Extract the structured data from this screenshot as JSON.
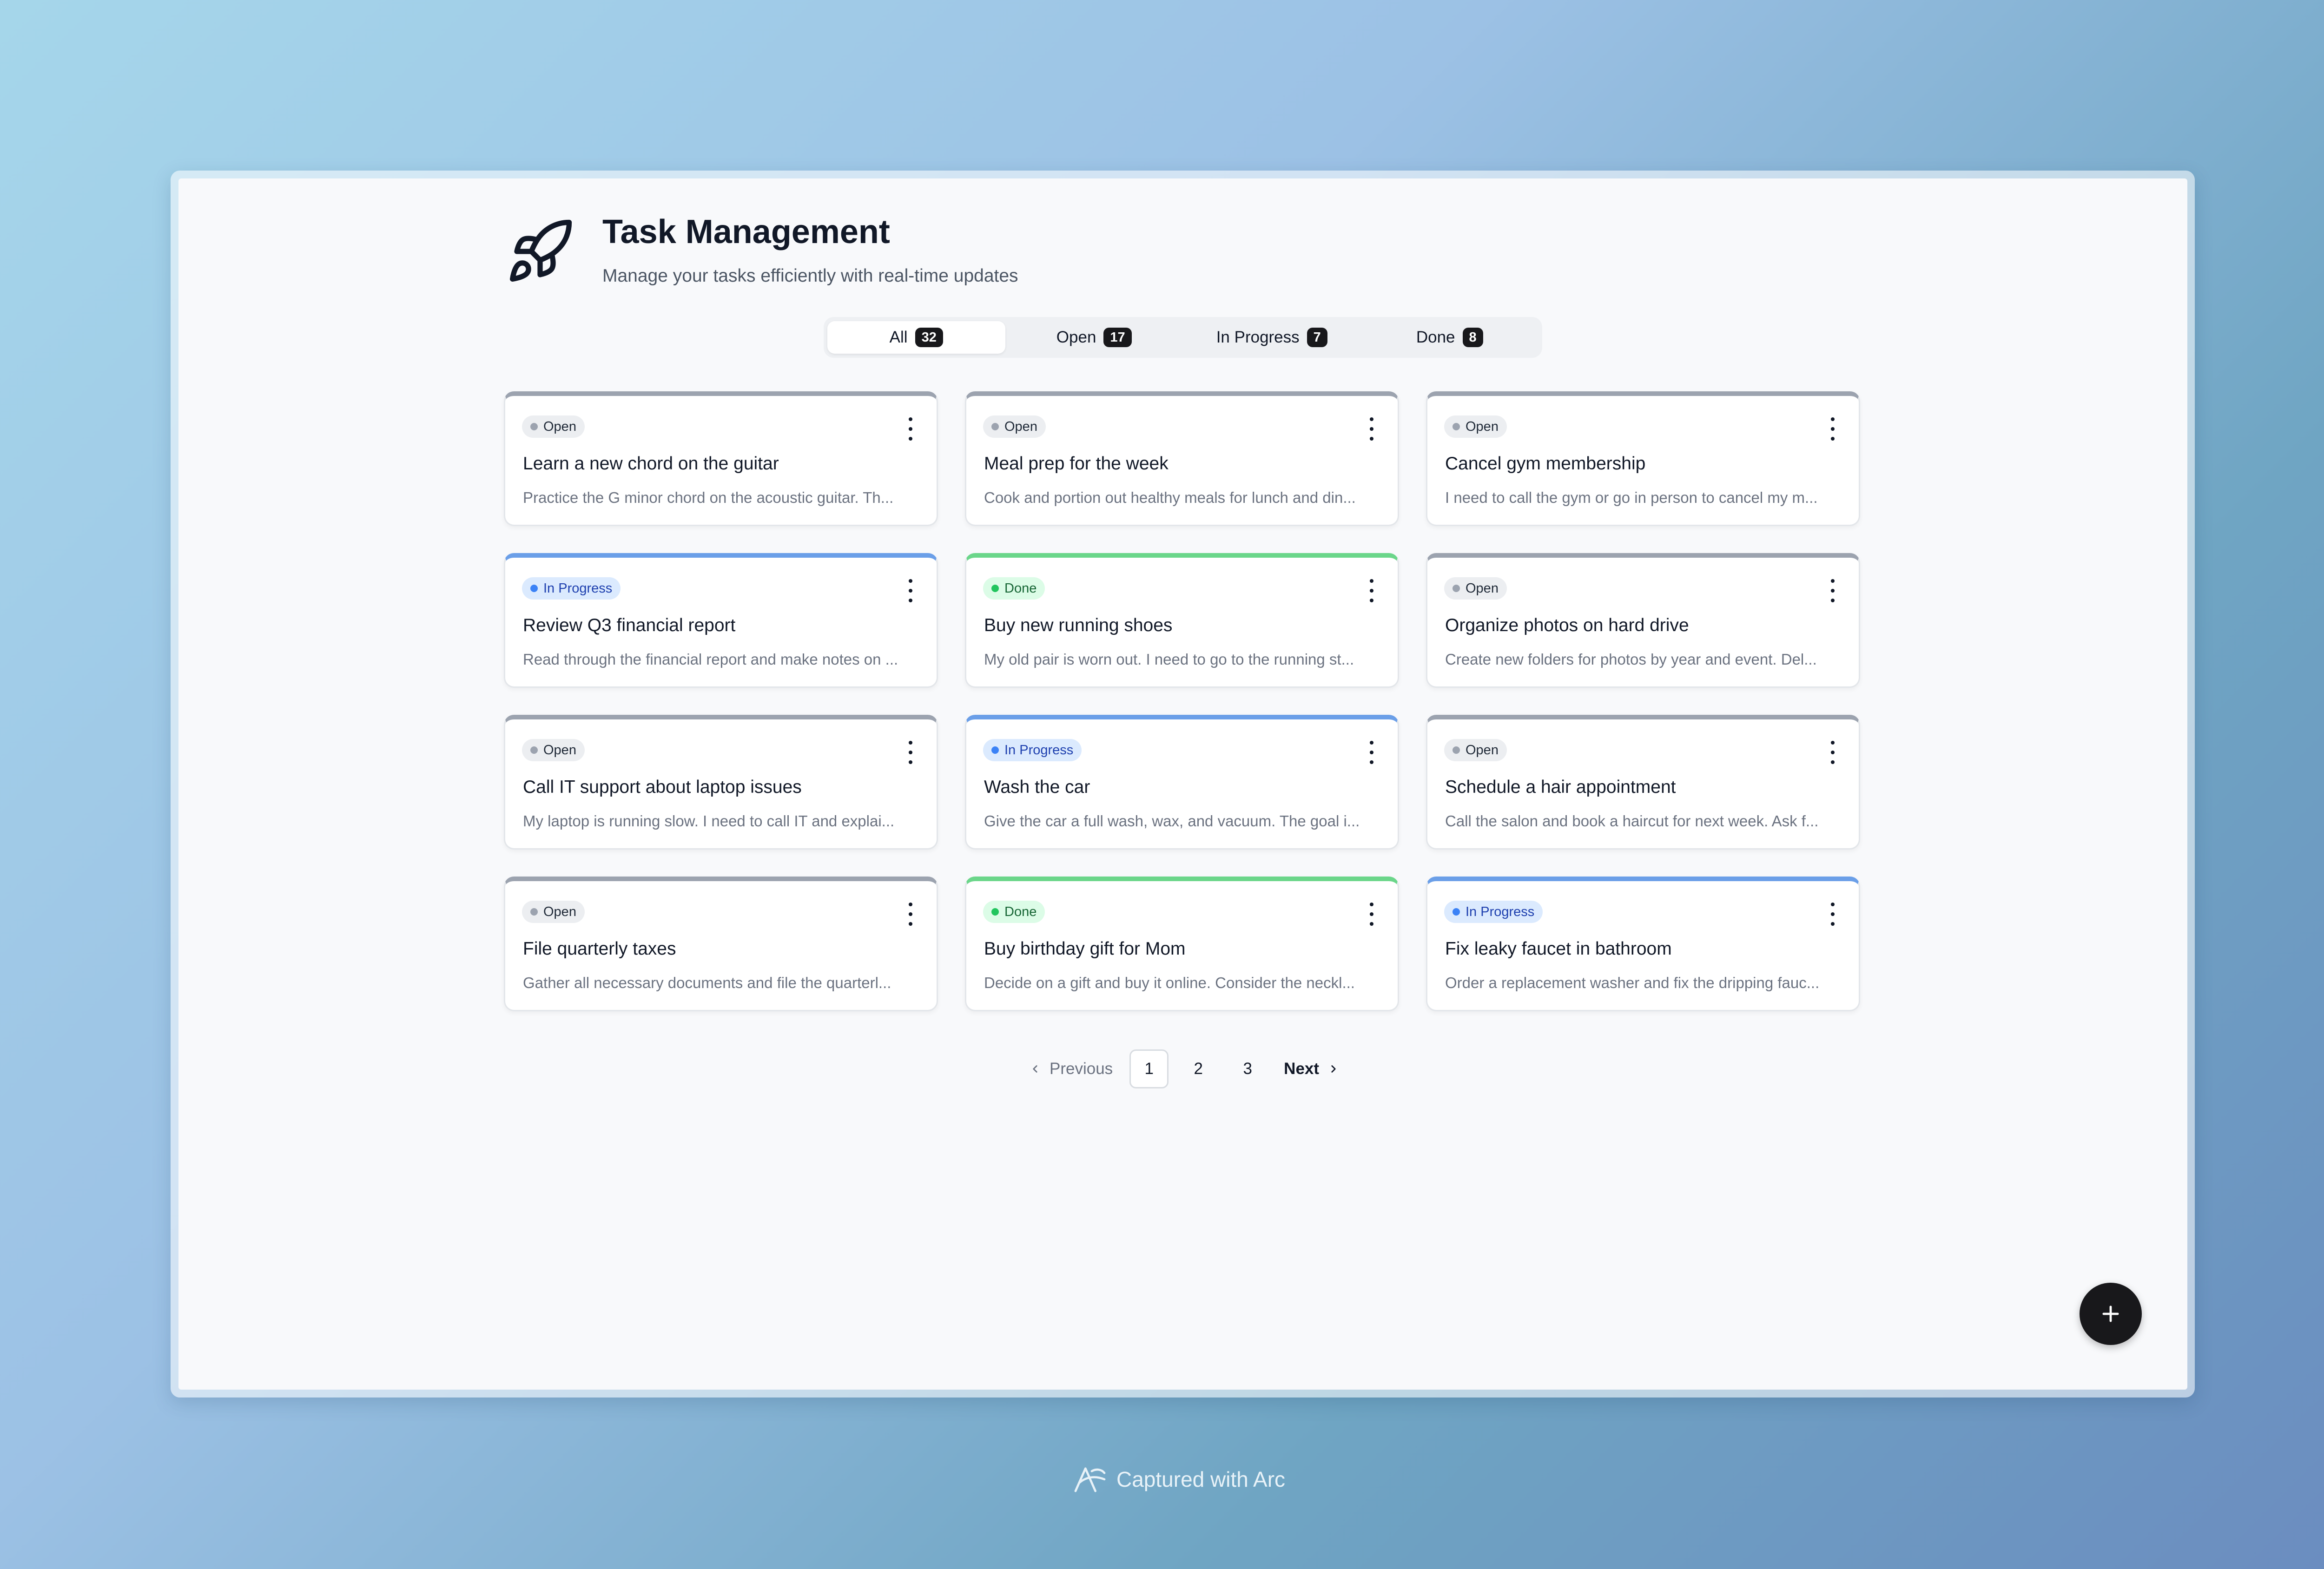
{
  "header": {
    "title": "Task Management",
    "subtitle": "Manage your tasks efficiently with real-time updates",
    "logo_icon": "rocket-icon"
  },
  "filters": [
    {
      "label": "All",
      "count": "32",
      "active": true
    },
    {
      "label": "Open",
      "count": "17",
      "active": false
    },
    {
      "label": "In Progress",
      "count": "7",
      "active": false
    },
    {
      "label": "Done",
      "count": "8",
      "active": false
    }
  ],
  "status_colors": {
    "Open": {
      "bar": "#9ca3af",
      "bg": "#eceef1",
      "dot": "#9ca3af",
      "text": "#1f2937"
    },
    "In Progress": {
      "bar": "#6b9fe8",
      "bg": "#dbeafe",
      "dot": "#3b82f6",
      "text": "#1e40af"
    },
    "Done": {
      "bar": "#6bd68a",
      "bg": "#dcfce7",
      "dot": "#22c55e",
      "text": "#166534"
    }
  },
  "tasks": [
    {
      "status": "Open",
      "title": "Learn a new chord on the guitar",
      "description": "Practice the G minor chord on the acoustic guitar. Th..."
    },
    {
      "status": "Open",
      "title": "Meal prep for the week",
      "description": "Cook and portion out healthy meals for lunch and din..."
    },
    {
      "status": "Open",
      "title": "Cancel gym membership",
      "description": "I need to call the gym or go in person to cancel my m..."
    },
    {
      "status": "In Progress",
      "title": "Review Q3 financial report",
      "description": "Read through the financial report and make notes on ..."
    },
    {
      "status": "Done",
      "title": "Buy new running shoes",
      "description": "My old pair is worn out. I need to go to the running st..."
    },
    {
      "status": "Open",
      "title": "Organize photos on hard drive",
      "description": "Create new folders for photos by year and event. Del..."
    },
    {
      "status": "Open",
      "title": "Call IT support about laptop issues",
      "description": "My laptop is running slow. I need to call IT and explai..."
    },
    {
      "status": "In Progress",
      "title": "Wash the car",
      "description": "Give the car a full wash, wax, and vacuum. The goal i..."
    },
    {
      "status": "Open",
      "title": "Schedule a hair appointment",
      "description": "Call the salon and book a haircut for next week. Ask f..."
    },
    {
      "status": "Open",
      "title": "File quarterly taxes",
      "description": "Gather all necessary documents and file the quarterl..."
    },
    {
      "status": "Done",
      "title": "Buy birthday gift for Mom",
      "description": "Decide on a gift and buy it online. Consider the neckl..."
    },
    {
      "status": "In Progress",
      "title": "Fix leaky faucet in bathroom",
      "description": "Order a replacement washer and fix the dripping fauc..."
    }
  ],
  "pagination": {
    "previous_label": "Previous",
    "next_label": "Next",
    "pages": [
      "1",
      "2",
      "3"
    ],
    "current_page": "1"
  },
  "fab": {
    "icon": "plus-icon"
  },
  "footer": {
    "text": "Captured with Arc",
    "icon": "arc-logo-icon"
  }
}
